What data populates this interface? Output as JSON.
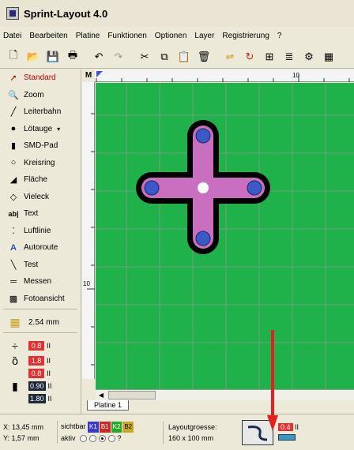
{
  "window": {
    "title": "Sprint-Layout 4.0"
  },
  "menu": [
    "Datei",
    "Bearbeiten",
    "Platine",
    "Funktionen",
    "Optionen",
    "Layer",
    "Registrierung",
    "?"
  ],
  "toolbar_icons": [
    "new-icon",
    "open-icon",
    "save-icon",
    "print-icon",
    "undo-icon",
    "redo-icon",
    "cut-icon",
    "copy-icon",
    "paste-icon",
    "delete-icon",
    "mirror-icon",
    "rotate-icon",
    "group-icon",
    "align-icon",
    "settings-icon",
    "more-icon"
  ],
  "tools": [
    {
      "label": "Standard",
      "icon": "arrow-cursor-icon",
      "active": true
    },
    {
      "label": "Zoom",
      "icon": "magnifier-icon"
    },
    {
      "label": "Leiterbahn",
      "icon": "track-icon"
    },
    {
      "label": "Lötauge",
      "icon": "pad-icon"
    },
    {
      "label": "SMD-Pad",
      "icon": "smd-pad-icon"
    },
    {
      "label": "Kreisring",
      "icon": "circle-ring-icon"
    },
    {
      "label": "Fläche",
      "icon": "area-icon"
    },
    {
      "label": "Vieleck",
      "icon": "polygon-icon"
    },
    {
      "label": "Text",
      "icon": "text-icon"
    },
    {
      "label": "Luftlinie",
      "icon": "airline-icon"
    },
    {
      "label": "Autoroute",
      "icon": "autoroute-icon"
    },
    {
      "label": "Test",
      "icon": "test-probe-icon"
    },
    {
      "label": "Messen",
      "icon": "ruler-icon"
    },
    {
      "label": "Fotoansicht",
      "icon": "photo-view-icon"
    }
  ],
  "grid": {
    "value": "2.54 mm"
  },
  "params": {
    "track_width": "0.8",
    "pad_outer": "1.8",
    "pad_inner": "0.8",
    "smd_width": "0.90",
    "smd_height": "1.80",
    "unit": "II"
  },
  "ruler": {
    "corner": "M",
    "top_label": "10",
    "left_label": "10"
  },
  "tab": {
    "label": "Platine 1"
  },
  "status": {
    "x": "X: 13,45 mm",
    "y": "Y: 1,57 mm",
    "visible_label": "sichtbar",
    "active_label": "aktiv",
    "layers": [
      {
        "name": "K1",
        "color": "#3a3ac8"
      },
      {
        "name": "B1",
        "color": "#c82828"
      },
      {
        "name": "K2",
        "color": "#28a828"
      },
      {
        "name": "B2",
        "color": "#c8a828"
      }
    ],
    "question": "?",
    "size_label": "Layoutgroesse:",
    "size_value": "160 x 100 mm",
    "route_value": "0.4",
    "route_unit": "II"
  },
  "colors": {
    "board": "#1fb24a",
    "copper_outline": "#000000",
    "track": "#c86fc0",
    "pad": "#3a5ac8",
    "arrow": "#e32020"
  }
}
